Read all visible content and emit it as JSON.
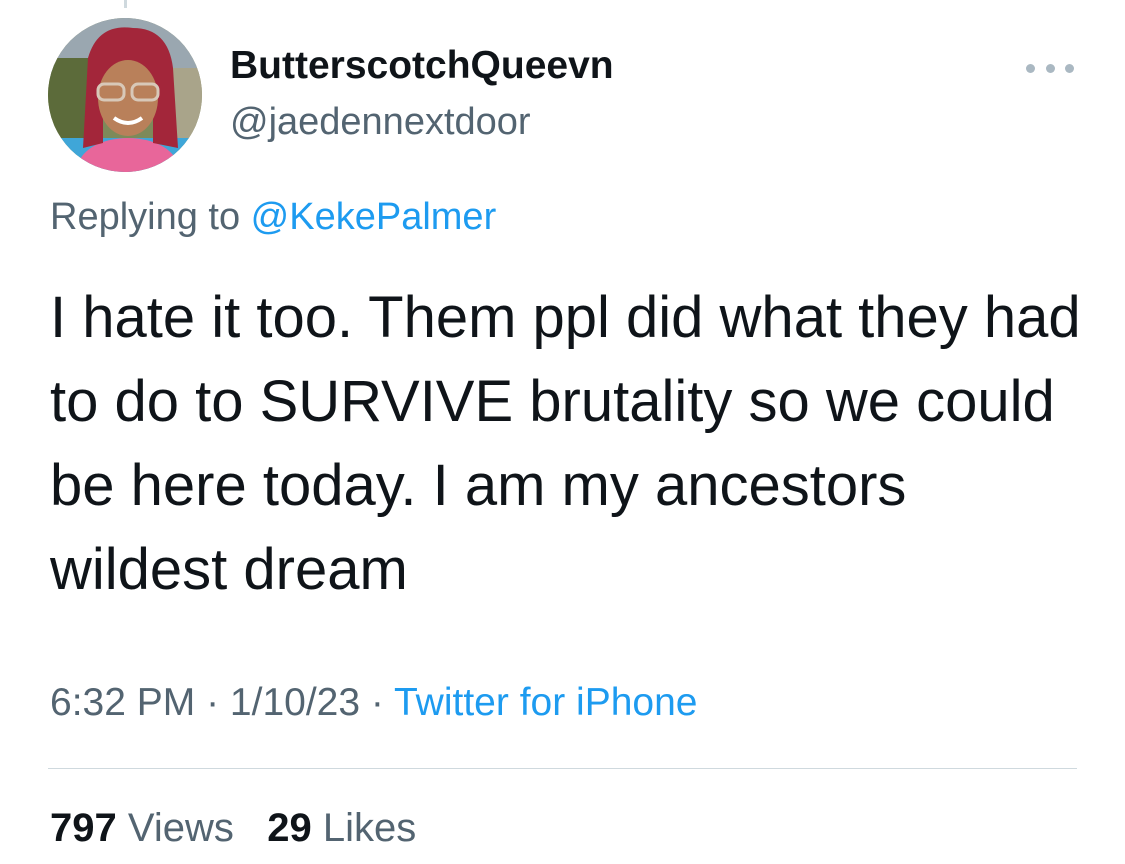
{
  "author": {
    "display_name": "ButterscotchQueevn",
    "handle": "@jaedennextdoor",
    "avatar_icon": "profile-photo"
  },
  "reply": {
    "prefix": "Replying to ",
    "mention": "@KekePalmer"
  },
  "tweet_text": "I hate it too. Them ppl did what they had to do to SURVIVE brutality so we could be here today. I am my ancestors wildest dream",
  "meta": {
    "time": "6:32 PM",
    "separator": " · ",
    "date": "1/10/23",
    "source": "Twitter for iPhone"
  },
  "stats": {
    "views_count": "797",
    "views_label": "Views",
    "likes_count": "29",
    "likes_label": "Likes"
  },
  "colors": {
    "link": "#1d9bf0",
    "secondary_text": "#536471",
    "primary_text": "#0f1419"
  }
}
